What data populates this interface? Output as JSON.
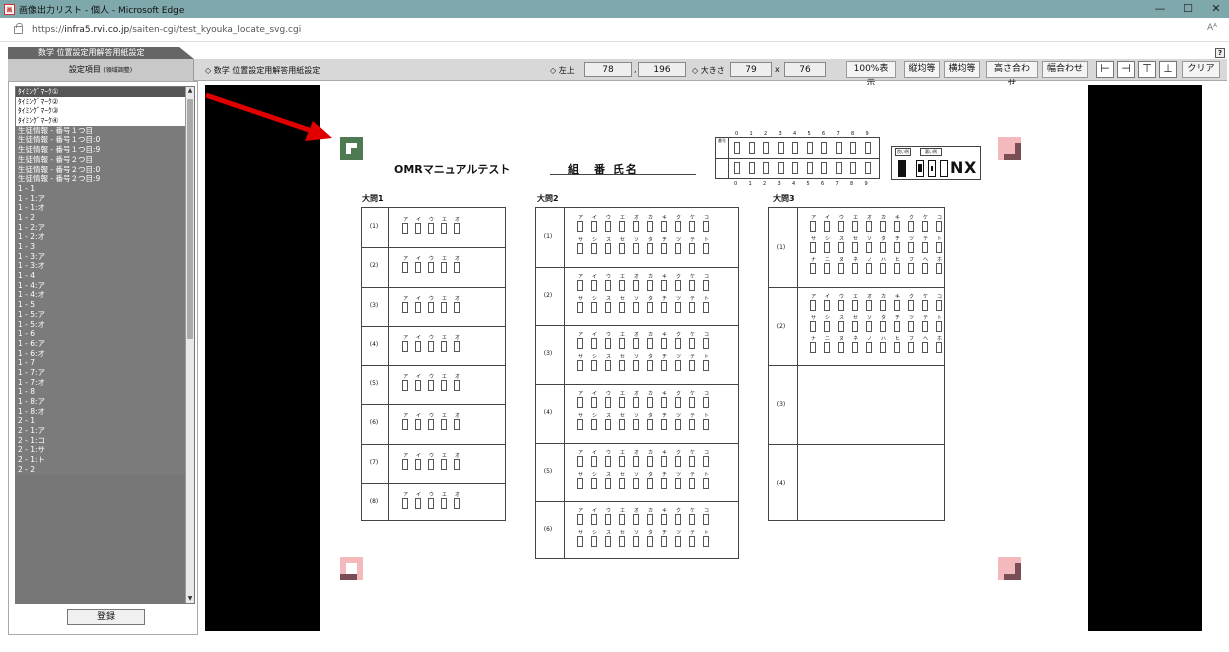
{
  "window": {
    "title": "画像出力リスト - 個人 - Microsoft Edge",
    "minimize": "—",
    "maximize": "☐",
    "close": "✕"
  },
  "address": {
    "url_prefix": "https://",
    "url_host": "infra5.rvi.co.jp",
    "url_path": "/saiten-cgi/test_kyouka_locate_svg.cgi",
    "read_aloud": "Aᴬ"
  },
  "tab": {
    "label": "数学 位置設定用解答用紙設定",
    "help": "?"
  },
  "toolbar": {
    "settings_header": "設定項目",
    "settings_header_small": "(領域調整)",
    "page_label": "◇ 数学 位置設定用解答用紙設定",
    "topleft_label": "◇ 左上",
    "x_value": "78",
    "comma": ",",
    "y_value": "196",
    "size_label": "◇ 大きさ",
    "w_value": "79",
    "times": "x",
    "h_value": "76",
    "btn_100": "100%表示",
    "btn_vertical_equal": "縦均等",
    "btn_horizontal_equal": "横均等",
    "btn_height_match": "高さ合わせ",
    "btn_width_match": "幅合わせ",
    "btn_clear": "クリア",
    "align_left": "⊢",
    "align_right": "⊣",
    "align_top": "⊤",
    "align_bottom": "⊥"
  },
  "list": {
    "items": [
      "ﾀｲﾐﾝｸﾞﾏｰｸ①",
      "ﾀｲﾐﾝｸﾞﾏｰｸ②",
      "ﾀｲﾐﾝｸﾞﾏｰｸ③",
      "ﾀｲﾐﾝｸﾞﾏｰｸ④",
      "生徒情報 - 番号１つ目",
      "生徒情報 - 番号１つ目:0",
      "生徒情報 - 番号１つ目:9",
      "生徒情報 - 番号２つ目",
      "生徒情報 - 番号２つ目:0",
      "生徒情報 - 番号２つ目:9",
      "1 - 1",
      "1 - 1:ア",
      "1 - 1:オ",
      "1 - 2",
      "1 - 2:ア",
      "1 - 2:オ",
      "1 - 3",
      "1 - 3:ア",
      "1 - 3:オ",
      "1 - 4",
      "1 - 4:ア",
      "1 - 4:オ",
      "1 - 5",
      "1 - 5:ア",
      "1 - 5:オ",
      "1 - 6",
      "1 - 6:ア",
      "1 - 6:オ",
      "1 - 7",
      "1 - 7:ア",
      "1 - 7:オ",
      "1 - 8",
      "1 - 8:ア",
      "1 - 8:オ",
      "2 - 1",
      "2 - 1:ア",
      "2 - 1:コ",
      "2 - 1:サ",
      "2 - 1:ト",
      "2 - 2"
    ],
    "register": "登録"
  },
  "sheet": {
    "title": "OMRマニュアルテスト",
    "class_label": "組　番 氏名",
    "q1": "大問1",
    "q2": "大問2",
    "q3": "大問3",
    "num_label": "番号",
    "digits": [
      "0",
      "1",
      "2",
      "3",
      "4",
      "5",
      "6",
      "7",
      "8",
      "9"
    ],
    "good_example": "良い例",
    "bad_example": "悪い例",
    "q1_rows": [
      "(1)",
      "(2)",
      "(3)",
      "(4)",
      "(5)",
      "(6)",
      "(7)",
      "(8)"
    ],
    "q2_rows": [
      "(1)",
      "(2)",
      "(3)",
      "(4)",
      "(5)",
      "(6)"
    ],
    "q3_rows": [
      "(1)",
      "(2)",
      "(3)",
      "(4)"
    ],
    "kana5": [
      "ア",
      "イ",
      "ウ",
      "エ",
      "オ"
    ],
    "kana_a_ko": [
      "ア",
      "イ",
      "ウ",
      "エ",
      "オ",
      "カ",
      "キ",
      "ク",
      "ケ",
      "コ"
    ],
    "kana_sa_to": [
      "サ",
      "シ",
      "ス",
      "セ",
      "ソ",
      "タ",
      "チ",
      "ツ",
      "テ",
      "ト"
    ],
    "kana_na_ho": [
      "ナ",
      "ニ",
      "ヌ",
      "ネ",
      "ノ",
      "ハ",
      "ヒ",
      "フ",
      "ヘ",
      "ホ"
    ]
  },
  "colors": {
    "titlebar": "#7fa8ad",
    "mark_green": "#4e7a52",
    "mark_pink": "#f4b9bd",
    "mark_brown": "#7a4e55",
    "arrow": "#e00000"
  }
}
